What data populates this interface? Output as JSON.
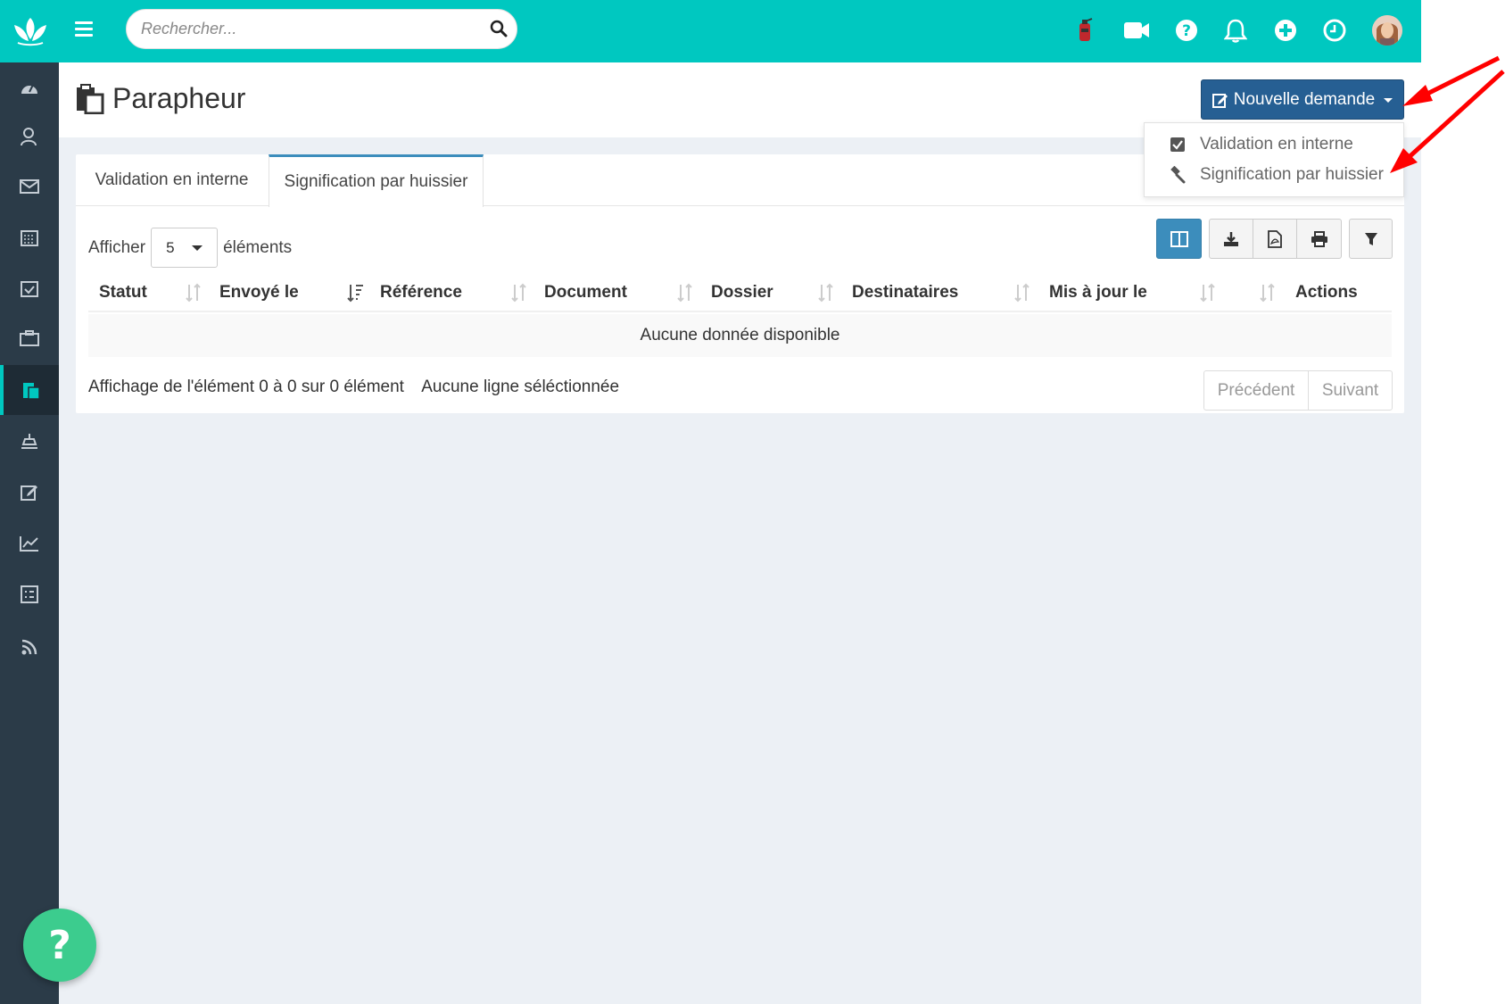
{
  "search": {
    "placeholder": "Rechercher..."
  },
  "page": {
    "title": "Parapheur"
  },
  "actions": {
    "new_request_label": "Nouvelle demande",
    "dropdown": [
      {
        "label": "Validation en interne",
        "icon": "checkbox-icon"
      },
      {
        "label": "Signification par huissier",
        "icon": "gavel-icon"
      }
    ]
  },
  "tabs": [
    {
      "label": "Validation en interne",
      "active": false
    },
    {
      "label": "Signification par huissier",
      "active": true
    }
  ],
  "table": {
    "show_prefix": "Afficher",
    "page_size": "5",
    "show_suffix": "éléments",
    "columns": [
      "Statut",
      "Envoyé le",
      "Référence",
      "Document",
      "Dossier",
      "Destinataires",
      "Mis à jour le",
      "Actions"
    ],
    "empty_message": "Aucune donnée disponible",
    "info": "Affichage de l'élément 0 à 0 sur 0 élément",
    "selection_info": "Aucune ligne séléctionnée",
    "prev_label": "Précédent",
    "next_label": "Suivant"
  },
  "help": {
    "label": "?"
  },
  "colors": {
    "topbar": "#00c8c0",
    "sidebar": "#2b3b48",
    "primary_button": "#265f93",
    "tool_primary": "#3c8dbc",
    "help_button": "#3ccc8e",
    "annotation_arrow": "#ff0000"
  }
}
